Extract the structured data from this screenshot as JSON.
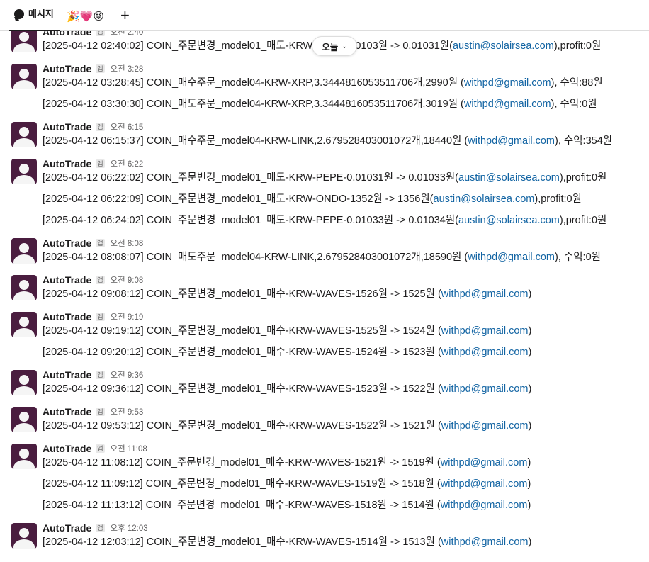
{
  "tabs": {
    "messages_label": "메시지",
    "emoji_tab": "🎉💗😜",
    "add_label": "+"
  },
  "date_divider": {
    "label": "오늘",
    "chevron": "⌄"
  },
  "messages": [
    {
      "sender": "AutoTrade",
      "badge": "앱",
      "time": "오전 2:40",
      "lines": [
        {
          "pre": "[2025-04-12 02:40:02] COIN_주문변경_model01_매도-KRW-PEPE-0.0103원 -> 0.01031원(",
          "email": "austin@solairsea.com",
          "post": "),profit:0원"
        }
      ]
    },
    {
      "sender": "AutoTrade",
      "badge": "앱",
      "time": "오전 3:28",
      "lines": [
        {
          "pre": "[2025-04-12 03:28:45] COIN_매수주문_model04-KRW-XRP,3.3444816053511706개,2990원 (",
          "email": "withpd@gmail.com",
          "post": "), 수익:88원"
        },
        {
          "pre": "[2025-04-12 03:30:30] COIN_매도주문_model04-KRW-XRP,3.3444816053511706개,3019원 (",
          "email": "withpd@gmail.com",
          "post": "), 수익:0원"
        }
      ]
    },
    {
      "sender": "AutoTrade",
      "badge": "앱",
      "time": "오전 6:15",
      "lines": [
        {
          "pre": "[2025-04-12 06:15:37] COIN_매수주문_model04-KRW-LINK,2.679528403001072개,18440원 (",
          "email": "withpd@gmail.com",
          "post": "), 수익:354원"
        }
      ]
    },
    {
      "sender": "AutoTrade",
      "badge": "앱",
      "time": "오전 6:22",
      "lines": [
        {
          "pre": "[2025-04-12 06:22:02] COIN_주문변경_model01_매도-KRW-PEPE-0.01031원 -> 0.01033원(",
          "email": "austin@solairsea.com",
          "post": "),profit:0원"
        },
        {
          "pre": "[2025-04-12 06:22:09] COIN_주문변경_model01_매도-KRW-ONDO-1352원 -> 1356원(",
          "email": "austin@solairsea.com",
          "post": "),profit:0원"
        },
        {
          "pre": "[2025-04-12 06:24:02] COIN_주문변경_model01_매도-KRW-PEPE-0.01033원 -> 0.01034원(",
          "email": "austin@solairsea.com",
          "post": "),profit:0원"
        }
      ]
    },
    {
      "sender": "AutoTrade",
      "badge": "앱",
      "time": "오전 8:08",
      "lines": [
        {
          "pre": "[2025-04-12 08:08:07] COIN_매도주문_model04-KRW-LINK,2.679528403001072개,18590원 (",
          "email": "withpd@gmail.com",
          "post": "), 수익:0원"
        }
      ]
    },
    {
      "sender": "AutoTrade",
      "badge": "앱",
      "time": "오전 9:08",
      "lines": [
        {
          "pre": "[2025-04-12 09:08:12] COIN_주문변경_model01_매수-KRW-WAVES-1526원 -> 1525원 (",
          "email": "withpd@gmail.com",
          "post": ")"
        }
      ]
    },
    {
      "sender": "AutoTrade",
      "badge": "앱",
      "time": "오전 9:19",
      "lines": [
        {
          "pre": "[2025-04-12 09:19:12] COIN_주문변경_model01_매수-KRW-WAVES-1525원 -> 1524원 (",
          "email": "withpd@gmail.com",
          "post": ")"
        },
        {
          "pre": "[2025-04-12 09:20:12] COIN_주문변경_model01_매수-KRW-WAVES-1524원 -> 1523원 (",
          "email": "withpd@gmail.com",
          "post": ")"
        }
      ]
    },
    {
      "sender": "AutoTrade",
      "badge": "앱",
      "time": "오전 9:36",
      "lines": [
        {
          "pre": "[2025-04-12 09:36:12] COIN_주문변경_model01_매수-KRW-WAVES-1523원 -> 1522원 (",
          "email": "withpd@gmail.com",
          "post": ")"
        }
      ]
    },
    {
      "sender": "AutoTrade",
      "badge": "앱",
      "time": "오전 9:53",
      "lines": [
        {
          "pre": "[2025-04-12 09:53:12] COIN_주문변경_model01_매수-KRW-WAVES-1522원 -> 1521원 (",
          "email": "withpd@gmail.com",
          "post": ")"
        }
      ]
    },
    {
      "sender": "AutoTrade",
      "badge": "앱",
      "time": "오전 11:08",
      "lines": [
        {
          "pre": "[2025-04-12 11:08:12] COIN_주문변경_model01_매수-KRW-WAVES-1521원 -> 1519원 (",
          "email": "withpd@gmail.com",
          "post": ")"
        },
        {
          "pre": "[2025-04-12 11:09:12] COIN_주문변경_model01_매수-KRW-WAVES-1519원 -> 1518원 (",
          "email": "withpd@gmail.com",
          "post": ")"
        },
        {
          "pre": "[2025-04-12 11:13:12] COIN_주문변경_model01_매수-KRW-WAVES-1518원 -> 1514원 (",
          "email": "withpd@gmail.com",
          "post": ")"
        }
      ]
    },
    {
      "sender": "AutoTrade",
      "badge": "앱",
      "time": "오후 12:03",
      "lines": [
        {
          "pre": "[2025-04-12 12:03:12] COIN_주문변경_model01_매수-KRW-WAVES-1514원 -> 1513원 (",
          "email": "withpd@gmail.com",
          "post": ")"
        }
      ]
    }
  ]
}
